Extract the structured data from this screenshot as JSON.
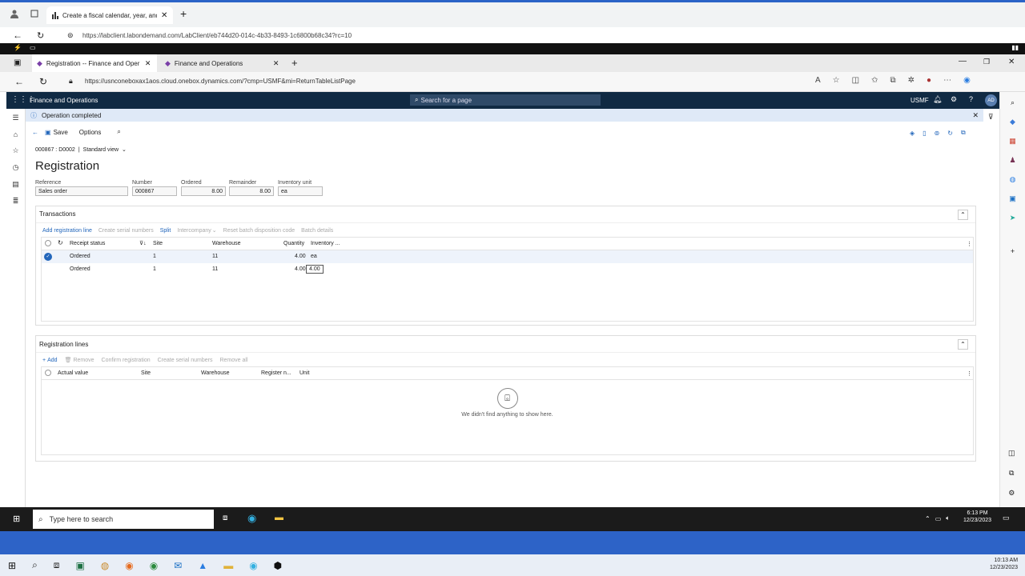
{
  "outer_browser": {
    "tab_title": "Create a fiscal calendar, year, and...",
    "address": "https://labclient.labondemand.com/LabClient/eb744d20-014c-4b33-8493-1c6800b68c34?rc=10"
  },
  "edge": {
    "tabs": [
      {
        "label": "Registration -- Finance and Oper"
      },
      {
        "label": "Finance and Operations"
      }
    ],
    "address": "https://usnconeboxax1aos.cloud.onebox.dynamics.com/?cmp=USMF&mi=ReturnTableListPage"
  },
  "app": {
    "title": "Finance and Operations",
    "search_placeholder": "Search for a page",
    "company": "USMF",
    "user_initials": "AD"
  },
  "notification": {
    "text": "Operation completed"
  },
  "toolbar": {
    "save": "Save",
    "options": "Options"
  },
  "breadcrumb": {
    "record": "000867 : D0002",
    "view": "Standard view"
  },
  "page_title": "Registration",
  "header_fields": [
    {
      "label": "Reference",
      "value": "Sales order"
    },
    {
      "label": "Number",
      "value": "000867"
    },
    {
      "label": "Ordered",
      "value": "8.00"
    },
    {
      "label": "Remainder",
      "value": "8.00"
    },
    {
      "label": "Inventory unit",
      "value": "ea"
    }
  ],
  "transactions": {
    "title": "Transactions",
    "actions": [
      "Add registration line",
      "Create serial numbers",
      "Split",
      "Intercompany",
      "Reset batch disposition code",
      "Batch details"
    ],
    "columns": [
      "Receipt status",
      "Site",
      "Warehouse",
      "Quantity",
      "Inventory ..."
    ],
    "rows": [
      {
        "status": "Ordered",
        "site": "1",
        "warehouse": "11",
        "quantity": "4.00",
        "unit": "ea"
      },
      {
        "status": "Ordered",
        "site": "1",
        "warehouse": "11",
        "quantity": "4.00",
        "unit": ""
      }
    ],
    "tooltip": "4.00"
  },
  "registration_lines": {
    "title": "Registration lines",
    "actions": [
      "Add",
      "Remove",
      "Confirm registration",
      "Create serial numbers",
      "Remove all"
    ],
    "columns": [
      "Actual value",
      "Site",
      "Warehouse",
      "Register n...",
      "Unit"
    ],
    "empty_message": "We didn't find anything to show here."
  },
  "inner_taskbar": {
    "search_placeholder": "Type here to search",
    "time": "6:13 PM",
    "date": "12/23/2023"
  },
  "outer_taskbar": {
    "time": "10:13 AM",
    "date": "12/23/2023"
  },
  "colors": {
    "accent": "#2266bb",
    "app_bar": "#102a43",
    "selected_row": "#eef3fb",
    "notification_bg": "#dfe9f7"
  }
}
